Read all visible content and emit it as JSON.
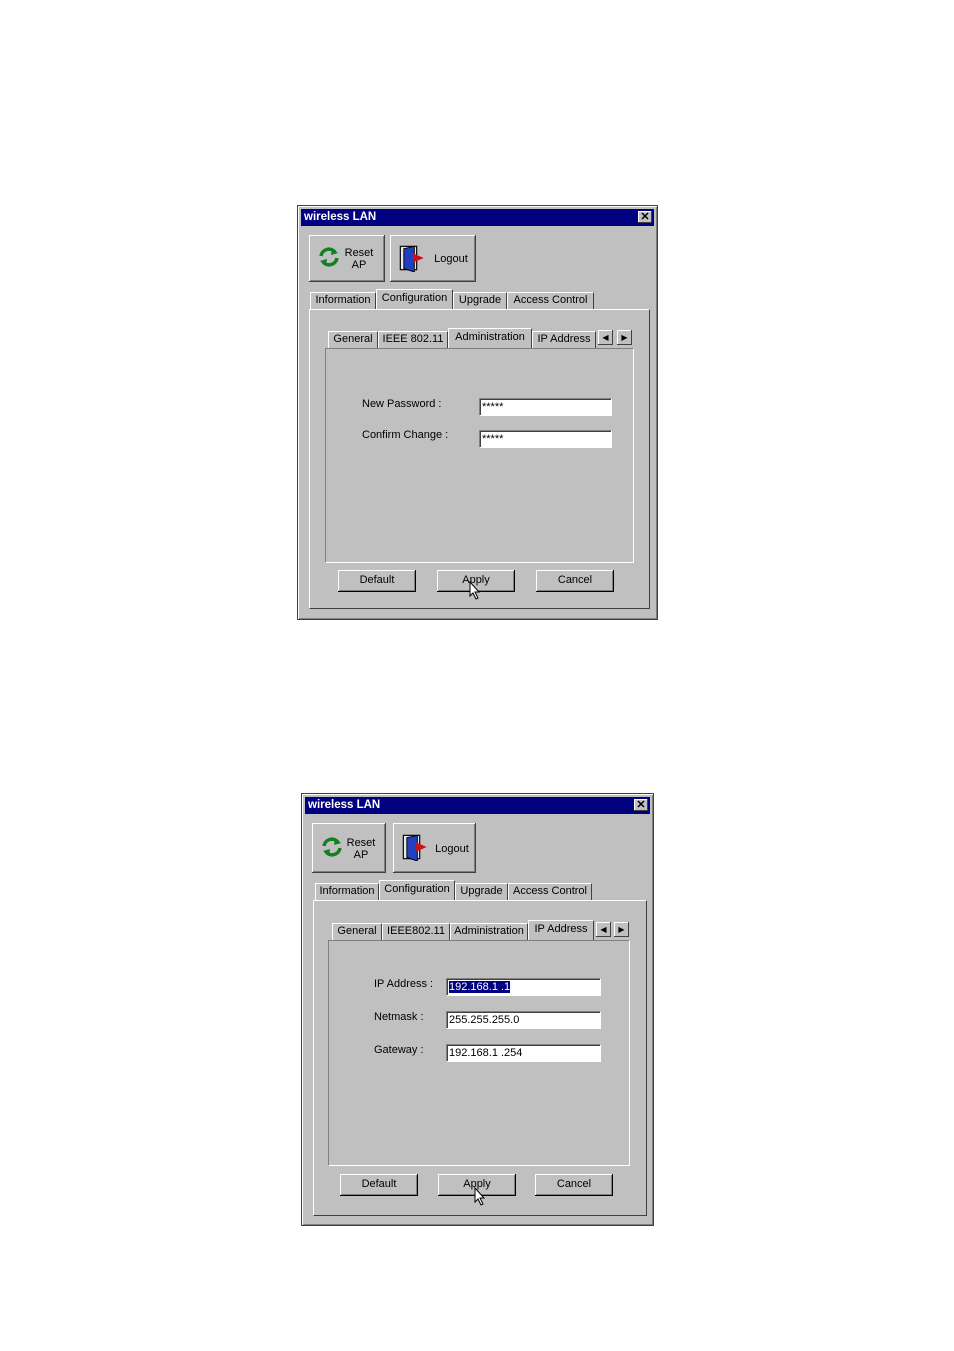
{
  "dialogs": [
    {
      "title": "wireless LAN",
      "toolbar": {
        "reset_line1": "Reset",
        "reset_line2": "AP",
        "logout": "Logout"
      },
      "main_tabs": [
        "Information",
        "Configuration",
        "Upgrade",
        "Access Control"
      ],
      "sub_tabs": [
        "General",
        "IEEE 802.11",
        "Administration",
        "IP Address"
      ],
      "active_main_tab": "Configuration",
      "active_sub_tab": "Administration",
      "fields": [
        {
          "label": "New Password :",
          "value": "*****"
        },
        {
          "label": "Confirm Change :",
          "value": "*****"
        }
      ],
      "buttons": [
        "Default",
        "Apply",
        "Cancel"
      ]
    },
    {
      "title": "wireless LAN",
      "toolbar": {
        "reset_line1": "Reset",
        "reset_line2": "AP",
        "logout": "Logout"
      },
      "main_tabs": [
        "Information",
        "Configuration",
        "Upgrade",
        "Access Control"
      ],
      "sub_tabs": [
        "General",
        "IEEE802.11",
        "Administration",
        "IP Address"
      ],
      "active_main_tab": "Configuration",
      "active_sub_tab": "IP Address",
      "fields": [
        {
          "label": "IP Address :",
          "value": "192.168.1  .1"
        },
        {
          "label": "Netmask :",
          "value": "255.255.255.0"
        },
        {
          "label": "Gateway :",
          "value": "192.168.1  .254"
        }
      ],
      "buttons": [
        "Default",
        "Apply",
        "Cancel"
      ]
    }
  ],
  "icons": {
    "close": "close-icon",
    "reset": "refresh-icon",
    "logout": "door-exit-icon",
    "scroll_left": "arrow-left-icon",
    "scroll_right": "arrow-right-icon",
    "cursor": "mouse-pointer-icon"
  },
  "colors": {
    "titlebar": "#000080",
    "face": "#c0c0c0",
    "selection": "#000080"
  }
}
